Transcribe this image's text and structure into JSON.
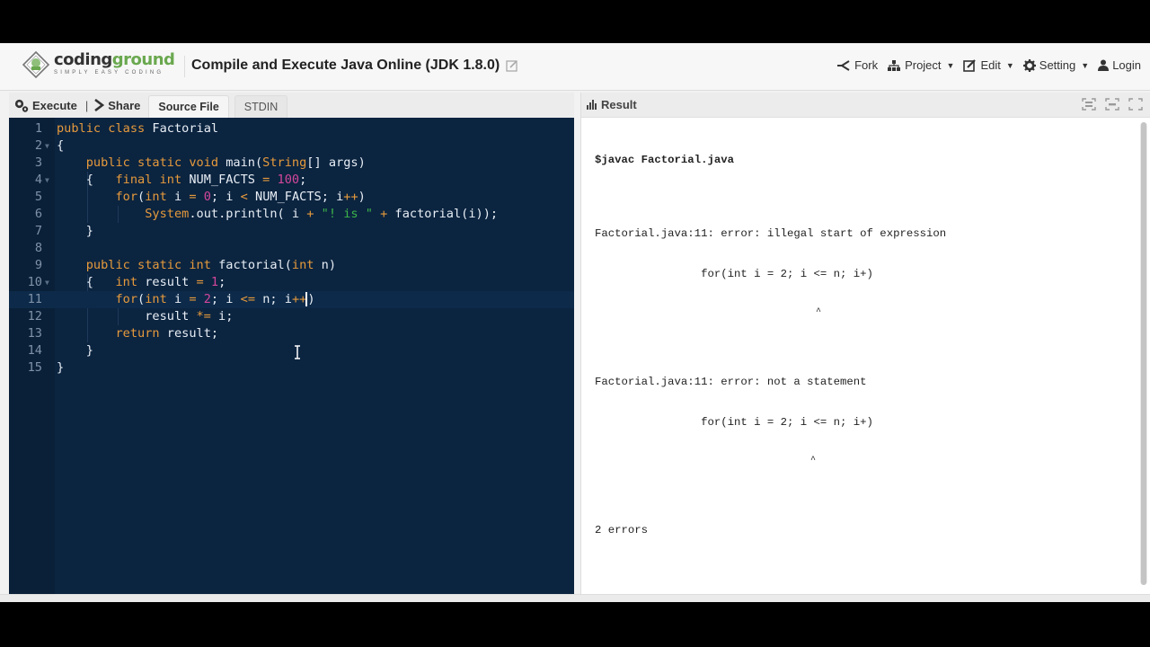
{
  "header": {
    "logo_name_part1": "coding",
    "logo_name_part2": "ground",
    "logo_tagline": "SIMPLY EASY CODING",
    "title": "Compile and Execute Java Online (JDK 1.8.0)",
    "nav": [
      {
        "label": "Fork",
        "icon": "fork-icon",
        "dropdown": false
      },
      {
        "label": "Project",
        "icon": "sitemap-icon",
        "dropdown": true
      },
      {
        "label": "Edit",
        "icon": "edit-icon",
        "dropdown": true
      },
      {
        "label": "Setting",
        "icon": "gear-icon",
        "dropdown": true
      },
      {
        "label": "Login",
        "icon": "user-icon",
        "dropdown": false
      }
    ]
  },
  "toolbar": {
    "execute_label": "Execute",
    "separator": "|",
    "share_label": "Share",
    "tabs": [
      {
        "label": "Source File",
        "active": true
      },
      {
        "label": "STDIN",
        "active": false
      }
    ]
  },
  "editor": {
    "active_line": 11,
    "lines": [
      {
        "n": "1",
        "fold": false
      },
      {
        "n": "2",
        "fold": true
      },
      {
        "n": "3",
        "fold": false
      },
      {
        "n": "4",
        "fold": true
      },
      {
        "n": "5",
        "fold": false
      },
      {
        "n": "6",
        "fold": false
      },
      {
        "n": "7",
        "fold": false
      },
      {
        "n": "8",
        "fold": false
      },
      {
        "n": "9",
        "fold": false
      },
      {
        "n": "10",
        "fold": true
      },
      {
        "n": "11",
        "fold": false
      },
      {
        "n": "12",
        "fold": false
      },
      {
        "n": "13",
        "fold": false
      },
      {
        "n": "14",
        "fold": false
      },
      {
        "n": "15",
        "fold": false
      }
    ],
    "code": [
      [
        [
          "kw",
          "public class "
        ],
        [
          "",
          "Factorial"
        ]
      ],
      [
        [
          "",
          "{"
        ]
      ],
      [
        [
          "",
          "    "
        ],
        [
          "kw",
          "public static void "
        ],
        [
          "",
          "main("
        ],
        [
          "kw",
          "String"
        ],
        [
          "",
          "[] args)"
        ]
      ],
      [
        [
          "",
          "    {   "
        ],
        [
          "kw",
          "final int "
        ],
        [
          "",
          "NUM_FACTS "
        ],
        [
          "op",
          "="
        ],
        [
          "",
          " "
        ],
        [
          "num",
          "100"
        ],
        [
          "",
          ";"
        ]
      ],
      [
        [
          "",
          "        "
        ],
        [
          "kw",
          "for"
        ],
        [
          "",
          "("
        ],
        [
          "kw",
          "int "
        ],
        [
          "",
          "i "
        ],
        [
          "op",
          "="
        ],
        [
          "",
          " "
        ],
        [
          "num",
          "0"
        ],
        [
          "",
          "; i "
        ],
        [
          "op",
          "<"
        ],
        [
          "",
          " NUM_FACTS; i"
        ],
        [
          "op",
          "++"
        ],
        [
          "",
          ")"
        ]
      ],
      [
        [
          "",
          "            "
        ],
        [
          "kw",
          "System"
        ],
        [
          "",
          ".out.println( i "
        ],
        [
          "op",
          "+"
        ],
        [
          "",
          " "
        ],
        [
          "str",
          "\"! is \""
        ],
        [
          "",
          " "
        ],
        [
          "op",
          "+"
        ],
        [
          "",
          " factorial(i));"
        ]
      ],
      [
        [
          "",
          "    }"
        ]
      ],
      [
        [
          "",
          ""
        ]
      ],
      [
        [
          "",
          "    "
        ],
        [
          "kw",
          "public static int "
        ],
        [
          "",
          "factorial("
        ],
        [
          "kw",
          "int "
        ],
        [
          "",
          "n)"
        ]
      ],
      [
        [
          "",
          "    {   "
        ],
        [
          "kw",
          "int "
        ],
        [
          "",
          "result "
        ],
        [
          "op",
          "="
        ],
        [
          "",
          " "
        ],
        [
          "num",
          "1"
        ],
        [
          "",
          ";"
        ]
      ],
      [
        [
          "",
          "        "
        ],
        [
          "kw",
          "for"
        ],
        [
          "",
          "("
        ],
        [
          "kw",
          "int "
        ],
        [
          "",
          "i "
        ],
        [
          "op",
          "="
        ],
        [
          "",
          " "
        ],
        [
          "num",
          "2"
        ],
        [
          "",
          "; i "
        ],
        [
          "op",
          "<="
        ],
        [
          "",
          " n; i"
        ],
        [
          "op",
          "++"
        ],
        [
          "cursor",
          ""
        ],
        [
          "",
          ")"
        ]
      ],
      [
        [
          "",
          "            result "
        ],
        [
          "op",
          "*="
        ],
        [
          "",
          " i;"
        ]
      ],
      [
        [
          "",
          "        "
        ],
        [
          "kw",
          "return "
        ],
        [
          "",
          "result;"
        ]
      ],
      [
        [
          "",
          "    }"
        ]
      ],
      [
        [
          "",
          "}"
        ]
      ]
    ]
  },
  "result": {
    "header_label": "Result",
    "command": "$javac Factorial.java",
    "errors": [
      {
        "message": "Factorial.java:11: error: illegal start of expression",
        "source": "                for(int i = 2; i <= n; i+)",
        "pointer": "                                         ^"
      },
      {
        "message": "Factorial.java:11: error: not a statement",
        "source": "                for(int i = 2; i <= n; i+)",
        "pointer": "                                        ^"
      }
    ],
    "summary": "2 errors"
  },
  "colors": {
    "editor_bg": "#0b2440",
    "keyword": "#e69a3c",
    "number": "#d3479b",
    "string": "#3cb54a",
    "brand_green": "#6aa84f"
  }
}
